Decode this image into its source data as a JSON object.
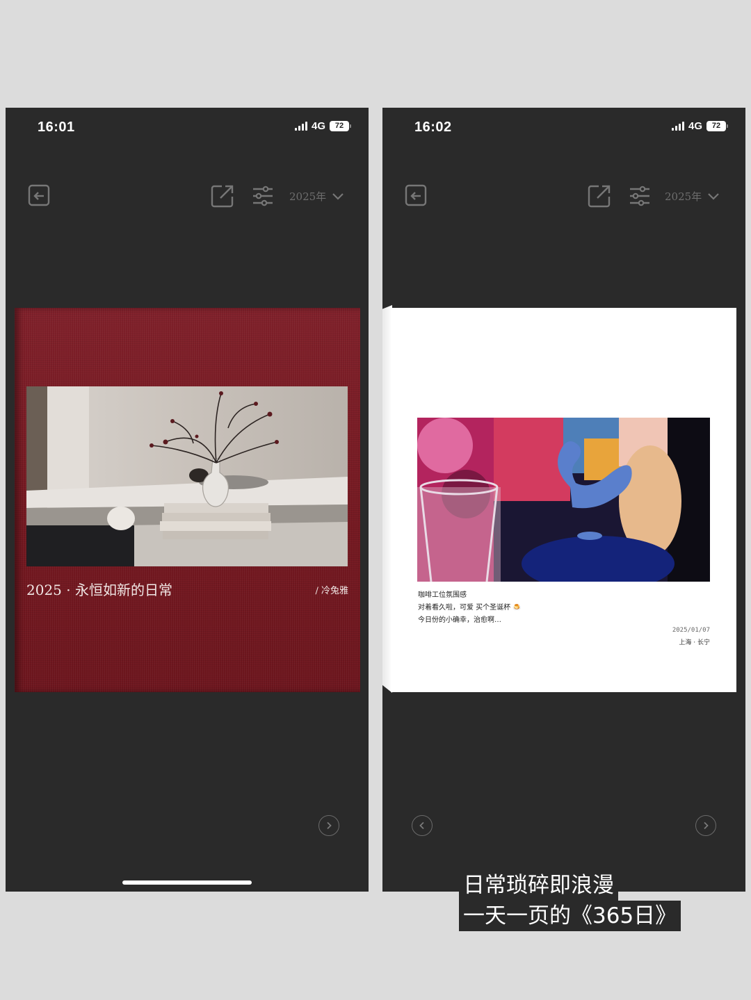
{
  "left_phone": {
    "status": {
      "time": "16:01",
      "network": "4G",
      "battery": "72"
    },
    "toolbar": {
      "year": "2025年"
    },
    "cover": {
      "title": "2025 · 永恒如新的日常",
      "author": "/ 冷兔雅"
    }
  },
  "right_phone": {
    "status": {
      "time": "16:02",
      "network": "4G",
      "battery": "72"
    },
    "toolbar": {
      "year": "2025年"
    },
    "page": {
      "lines": [
        "咖啡工位氛围感",
        "对着看久啦，可爱 买个圣诞杯 🍮",
        "今日份的小确幸，治愈啊…"
      ],
      "date": "2025/01/07",
      "location": "上海 · 长宁"
    }
  },
  "caption": {
    "line1": "日常琐碎即浪漫",
    "line2": "一天一页的《365日》"
  },
  "colors": {
    "cover_red": "#7a1a22",
    "app_bg": "#2a2a2a",
    "canvas_bg": "#dcdcdc"
  }
}
